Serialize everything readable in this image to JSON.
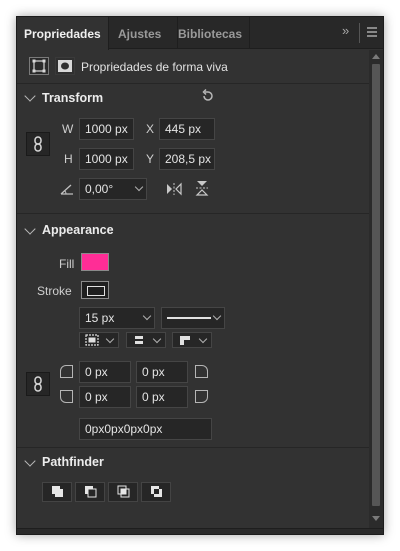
{
  "tabs": [
    {
      "label": "Propriedades",
      "active": true
    },
    {
      "label": "Ajustes",
      "active": false
    },
    {
      "label": "Bibliotecas",
      "active": false
    }
  ],
  "header": {
    "title": "Propriedades de forma viva"
  },
  "transform": {
    "title": "Transform",
    "w_label": "W",
    "w_value": "1000 px",
    "x_label": "X",
    "x_value": "445 px",
    "h_label": "H",
    "h_value": "1000 px",
    "y_label": "Y",
    "y_value": "208,5 px",
    "angle_value": "0,00°"
  },
  "appearance": {
    "title": "Appearance",
    "fill_label": "Fill",
    "fill_color": "#ff2d96",
    "stroke_label": "Stroke",
    "stroke_width": "15 px",
    "corners": {
      "tl": "0 px",
      "tr": "0 px",
      "bl": "0 px",
      "br": "0 px"
    },
    "corners_combined": "0px0px0px0px"
  },
  "pathfinder": {
    "title": "Pathfinder"
  }
}
